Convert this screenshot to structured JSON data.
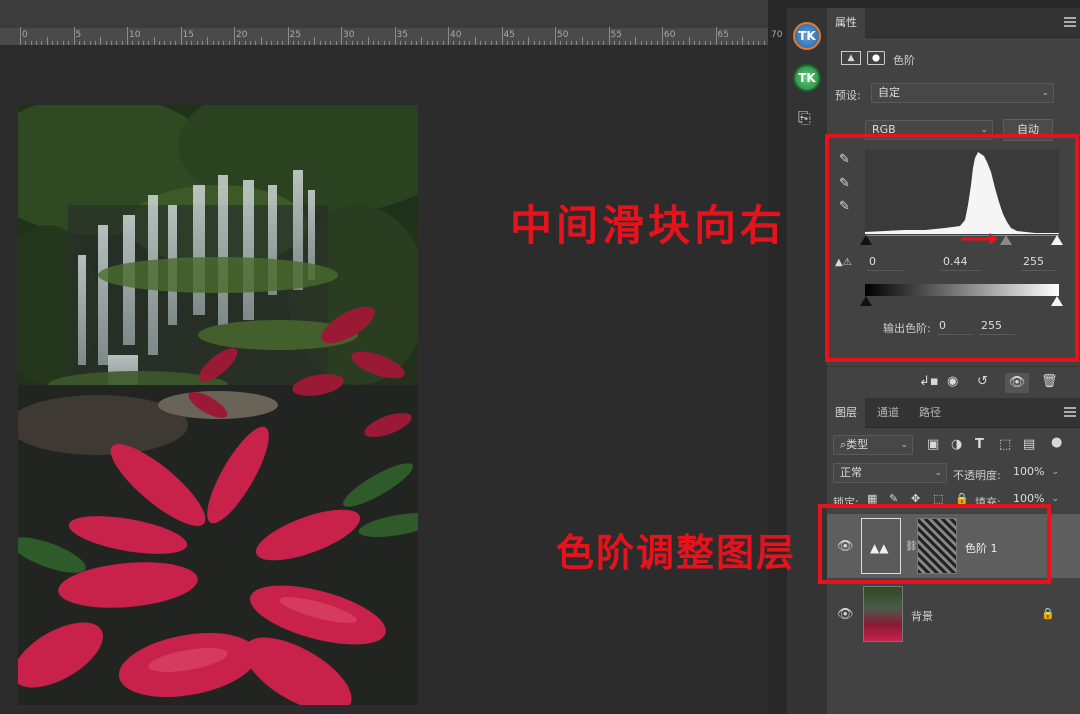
{
  "ruler": {
    "labels": [
      "0",
      "5",
      "10",
      "15",
      "20",
      "25",
      "30",
      "35",
      "40",
      "45",
      "50",
      "55",
      "60",
      "65",
      "70"
    ]
  },
  "strip": {
    "tk1": "TK",
    "tk2": "TK",
    "history_icon": "history-icon"
  },
  "properties": {
    "tab": "属性",
    "title": "色阶",
    "preset_label": "预设:",
    "preset_value": "自定",
    "channel_value": "RGB",
    "auto_button": "自动",
    "input_black": "0",
    "input_mid": "0.44",
    "input_white": "255",
    "output_label": "输出色阶:",
    "output_black": "0",
    "output_white": "255"
  },
  "layers": {
    "tabs": [
      "图层",
      "通道",
      "路径"
    ],
    "filter_kind": "类型",
    "blend_mode": "正常",
    "opacity_label": "不透明度:",
    "opacity_value": "100%",
    "lock_label": "锁定:",
    "fill_label": "填充:",
    "fill_value": "100%",
    "items": [
      {
        "name": "色阶 1"
      },
      {
        "name": "背景"
      }
    ]
  },
  "annotations": {
    "slider": "中间滑块向右",
    "layer": "色阶调整图层"
  },
  "colors": {
    "annotation": "#e6121c",
    "panel": "#424242",
    "canvas": "#2c2c2c"
  }
}
